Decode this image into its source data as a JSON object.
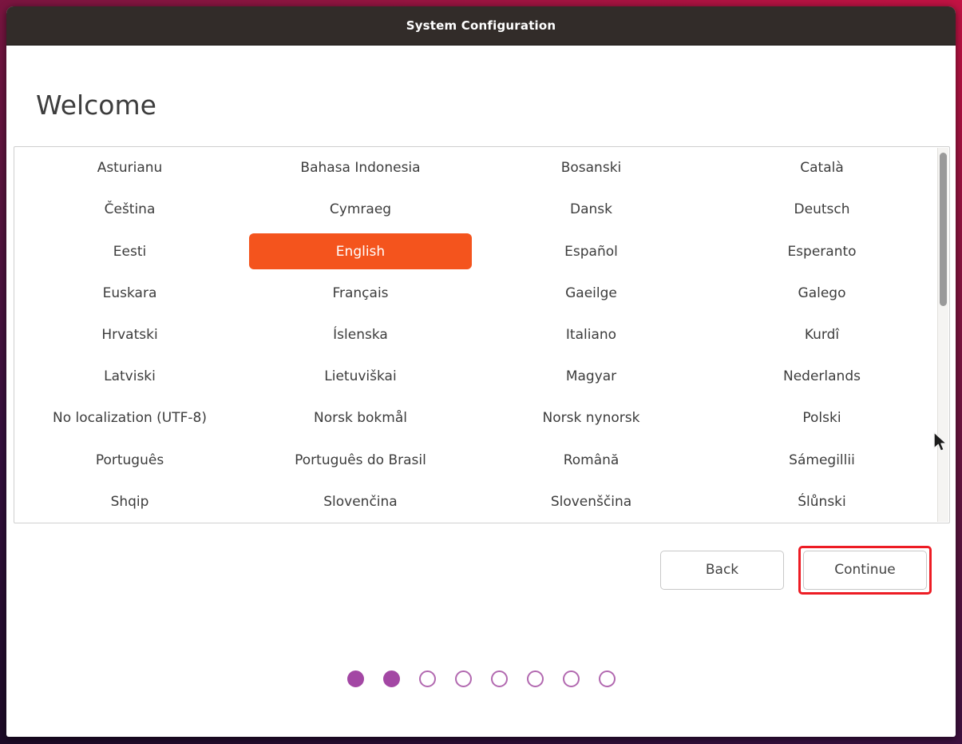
{
  "titlebar": {
    "title": "System Configuration"
  },
  "page": {
    "heading": "Welcome"
  },
  "language_list": {
    "selected": "English",
    "items": [
      "Asturianu",
      "Bahasa Indonesia",
      "Bosanski",
      "Català",
      "Čeština",
      "Cymraeg",
      "Dansk",
      "Deutsch",
      "Eesti",
      "English",
      "Español",
      "Esperanto",
      "Euskara",
      "Français",
      "Gaeilge",
      "Galego",
      "Hrvatski",
      "Íslenska",
      "Italiano",
      "Kurdî",
      "Latviski",
      "Lietuviškai",
      "Magyar",
      "Nederlands",
      "No localization (UTF-8)",
      "Norsk bokmål",
      "Norsk nynorsk",
      "Polski",
      "Português",
      "Português do Brasil",
      "Română",
      "Sámegillii",
      "Shqip",
      "Slovenčina",
      "Slovenščina",
      "Ślůnski"
    ],
    "scrollbar": {
      "thumb_position": "top",
      "thumb_height_fraction": 0.41
    }
  },
  "footer": {
    "back_label": "Back",
    "continue_label": "Continue"
  },
  "progress_dots": {
    "total": 8,
    "filled": 2
  },
  "colors": {
    "selected_bg": "#F4541D",
    "titlebar_bg": "#322C29",
    "dot_filled": "#A347A4",
    "dot_empty_border": "#B269B0",
    "annotation_red": "#ED1C24"
  }
}
